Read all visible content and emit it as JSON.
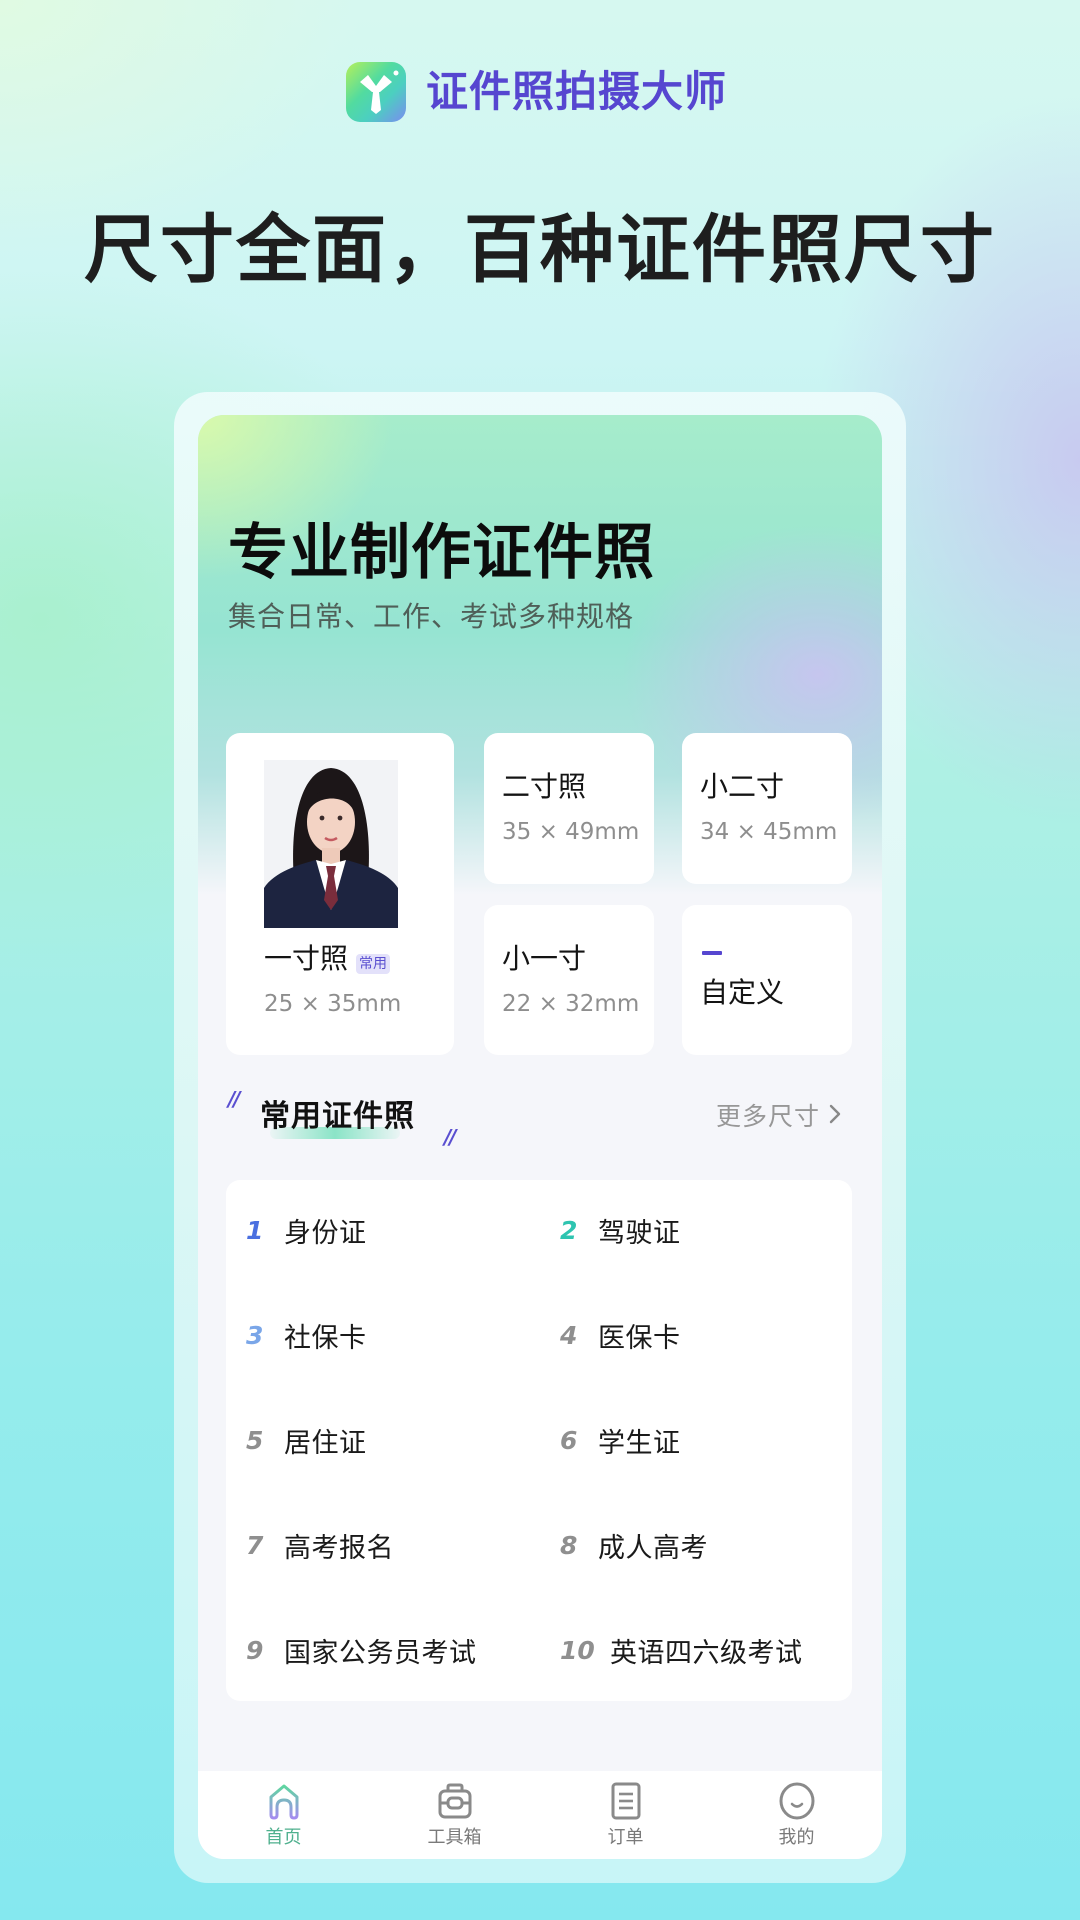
{
  "brand": {
    "app_name": "证件照拍摄大师",
    "logo_icon": "tie-icon",
    "accent_color": "#5646d0"
  },
  "headline": "尺寸全面，百种证件照尺寸",
  "screen": {
    "hero": {
      "title": "专业制作证件照",
      "subtitle": "集合日常、工作、考试多种规格"
    },
    "size_cards": {
      "featured": {
        "name": "一寸照",
        "badge": "常用",
        "dimensions": "25 × 35mm",
        "image": "portrait-sample"
      },
      "items": [
        {
          "name": "二寸照",
          "dimensions": "35 × 49mm"
        },
        {
          "name": "小二寸",
          "dimensions": "34 × 45mm"
        },
        {
          "name": "小一寸",
          "dimensions": "22 × 32mm"
        },
        {
          "name": "自定义",
          "dimensions": ""
        }
      ]
    },
    "common_section": {
      "title": "常用证件照",
      "more_label": "更多尺寸",
      "more_icon": "chevron-right-icon",
      "items": [
        {
          "num": "1",
          "label": "身份证",
          "num_color": "#4a6fe0"
        },
        {
          "num": "2",
          "label": "驾驶证",
          "num_color": "#2ec4b0"
        },
        {
          "num": "3",
          "label": "社保卡",
          "num_color": "#7aa6e8"
        },
        {
          "num": "4",
          "label": "医保卡",
          "num_color": "#8f8f8f"
        },
        {
          "num": "5",
          "label": "居住证",
          "num_color": "#8f8f8f"
        },
        {
          "num": "6",
          "label": "学生证",
          "num_color": "#8f8f8f"
        },
        {
          "num": "7",
          "label": "高考报名",
          "num_color": "#8f8f8f"
        },
        {
          "num": "8",
          "label": "成人高考",
          "num_color": "#8f8f8f"
        },
        {
          "num": "9",
          "label": "国家公务员考试",
          "num_color": "#8f8f8f"
        },
        {
          "num": "10",
          "label": "英语四六级考试",
          "num_color": "#8f8f8f"
        }
      ]
    },
    "bottom_nav": [
      {
        "label": "首页",
        "icon": "home-icon",
        "active": true
      },
      {
        "label": "工具箱",
        "icon": "toolbox-icon",
        "active": false
      },
      {
        "label": "订单",
        "icon": "order-list-icon",
        "active": false
      },
      {
        "label": "我的",
        "icon": "profile-smile-icon",
        "active": false
      }
    ]
  }
}
